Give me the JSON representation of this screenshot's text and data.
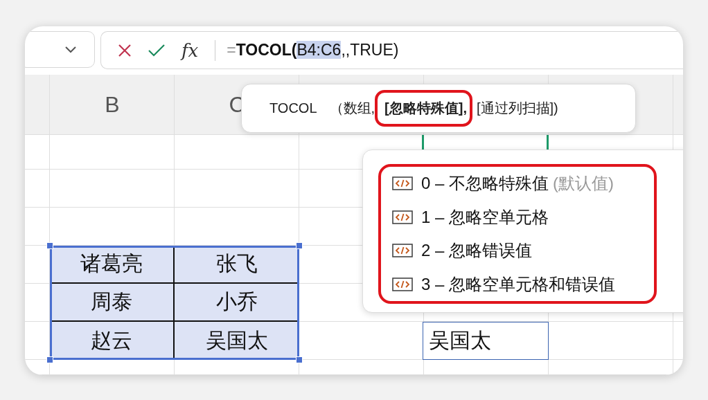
{
  "formula_bar": {
    "fx_label": "fx",
    "formula": [
      {
        "kind": "operator",
        "text": "="
      },
      {
        "kind": "function",
        "text": "TOCOL("
      },
      {
        "kind": "reference",
        "text": "B4:C6"
      },
      {
        "kind": "plain",
        "text": ",,TRUE)"
      }
    ]
  },
  "columns": [
    "B",
    "C"
  ],
  "source_range": {
    "selected": true,
    "rows": [
      [
        "诸葛亮",
        "张飞"
      ],
      [
        "周泰",
        "小乔"
      ],
      [
        "赵云",
        "吴国太"
      ]
    ]
  },
  "editing_cell": {
    "editing": true
  },
  "output_cells": [
    "吴国太"
  ],
  "tooltip": {
    "function": "TOCOL",
    "params": [
      {
        "text": "（数组,",
        "current": false
      },
      {
        "text": "[忽略特殊值],",
        "current": true
      },
      {
        "text": "[通过列扫描])",
        "current": false
      }
    ]
  },
  "dropdown": {
    "annotated": true,
    "items": [
      {
        "value": "0 – 不忽略特殊值",
        "note": "(默认值)"
      },
      {
        "value": "1 – 忽略空单元格"
      },
      {
        "value": "2 – 忽略错误值"
      },
      {
        "value": "3 – 忽略空单元格和错误值"
      }
    ]
  }
}
